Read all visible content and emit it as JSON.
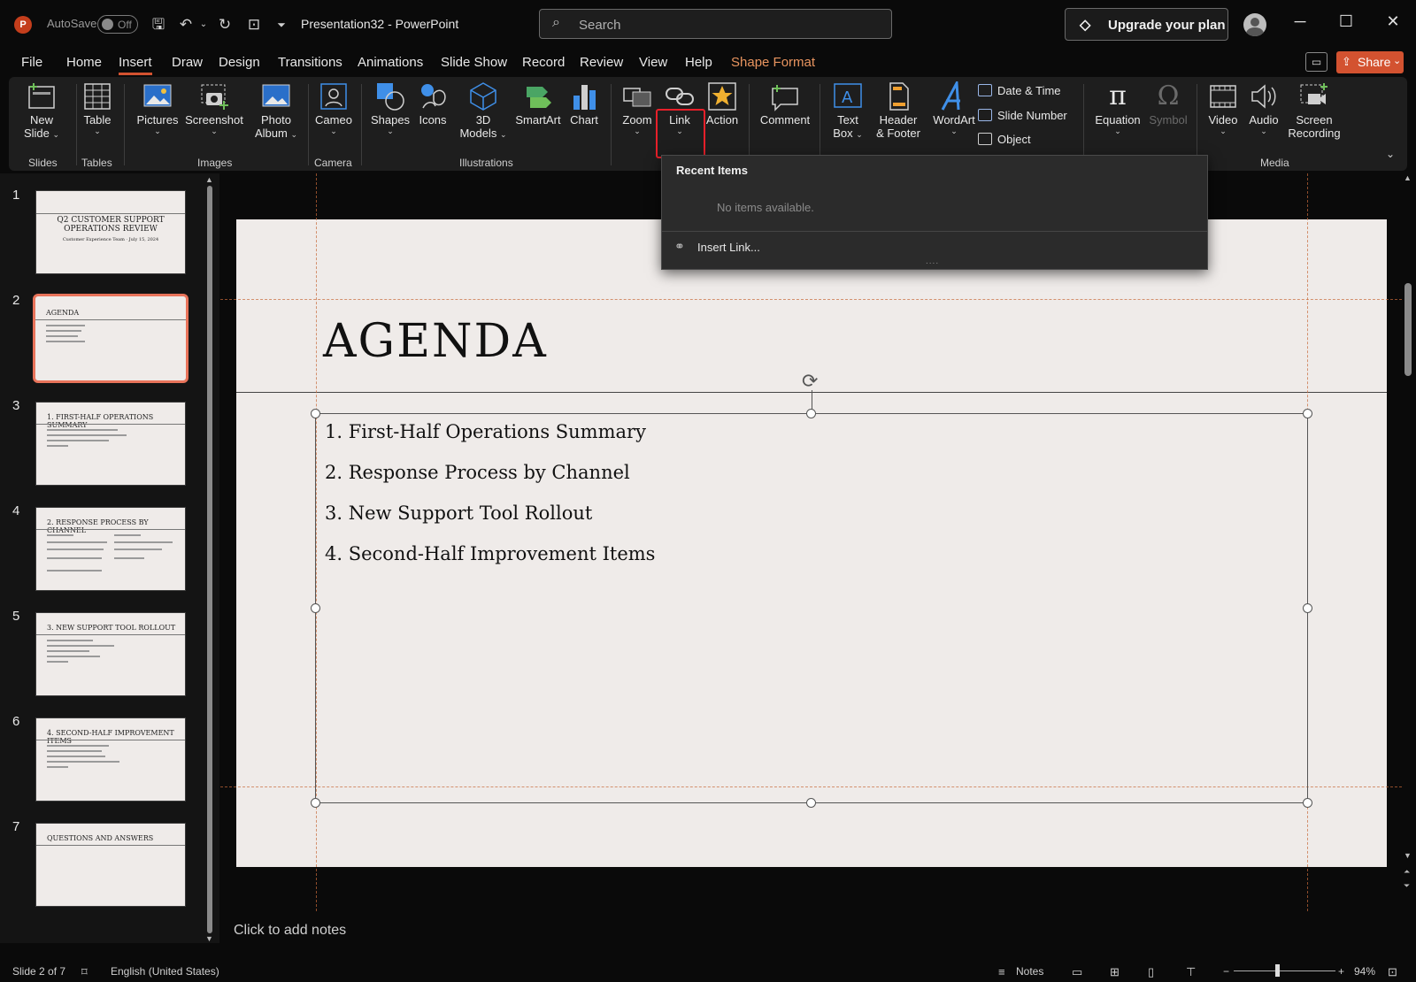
{
  "app": {
    "logo": "P",
    "autosave_label": "AutoSave",
    "autosave_state": "Off",
    "title": "Presentation32 - PowerPoint"
  },
  "search": {
    "placeholder": "Search"
  },
  "account": {
    "upgrade_label": "Upgrade your plan"
  },
  "menu": {
    "items": [
      "File",
      "Home",
      "Insert",
      "Draw",
      "Design",
      "Transitions",
      "Animations",
      "Slide Show",
      "Record",
      "Review",
      "View",
      "Help",
      "Shape Format"
    ],
    "active": "Insert",
    "share_label": "Share"
  },
  "ribbon": {
    "new_slide": {
      "line1": "New",
      "line2": "Slide"
    },
    "table": "Table",
    "pictures": "Pictures",
    "screenshot": "Screenshot",
    "photo_album": {
      "line1": "Photo",
      "line2": "Album"
    },
    "cameo": "Cameo",
    "shapes": "Shapes",
    "icons": "Icons",
    "models_3d": {
      "line1": "3D",
      "line2": "Models"
    },
    "smartart": "SmartArt",
    "chart": "Chart",
    "zoom": "Zoom",
    "link": "Link",
    "action": "Action",
    "comment": "Comment",
    "text_box": {
      "line1": "Text",
      "line2": "Box"
    },
    "header_footer": {
      "line1": "Header",
      "line2": "& Footer"
    },
    "wordart": "WordArt",
    "date_time": "Date & Time",
    "slide_number": "Slide Number",
    "object": "Object",
    "equation": "Equation",
    "symbol": "Symbol",
    "video": "Video",
    "audio": "Audio",
    "screen_recording": {
      "line1": "Screen",
      "line2": "Recording"
    },
    "groups": {
      "slides": "Slides",
      "tables": "Tables",
      "images": "Images",
      "camera": "Camera",
      "illustrations": "Illustrations",
      "media": "Media"
    }
  },
  "link_dropdown": {
    "header": "Recent Items",
    "empty_text": "No items available.",
    "insert_link": "Insert Link...",
    "grip": "...."
  },
  "slides": [
    {
      "num": "1",
      "title": "Q2 CUSTOMER SUPPORT OPERATIONS REVIEW",
      "subtitle": "Customer Experience Team · July 15, 2024"
    },
    {
      "num": "2",
      "title": "AGENDA"
    },
    {
      "num": "3",
      "title": "1. FIRST-HALF OPERATIONS SUMMARY"
    },
    {
      "num": "4",
      "title": "2. RESPONSE PROCESS BY CHANNEL"
    },
    {
      "num": "5",
      "title": "3. NEW SUPPORT TOOL ROLLOUT"
    },
    {
      "num": "6",
      "title": "4. SECOND-HALF IMPROVEMENT ITEMS"
    },
    {
      "num": "7",
      "title": "QUESTIONS AND ANSWERS"
    }
  ],
  "current_slide": {
    "title": "AGENDA",
    "items": [
      "1. First-Half Operations Summary",
      "2. Response Process by Channel",
      "3. New Support Tool Rollout",
      "4. Second-Half Improvement Items"
    ]
  },
  "notes": {
    "placeholder": "Click to add notes"
  },
  "status": {
    "slide_info": "Slide 2 of 7",
    "language": "English (United States)",
    "notes_label": "Notes",
    "zoom": "94%"
  }
}
